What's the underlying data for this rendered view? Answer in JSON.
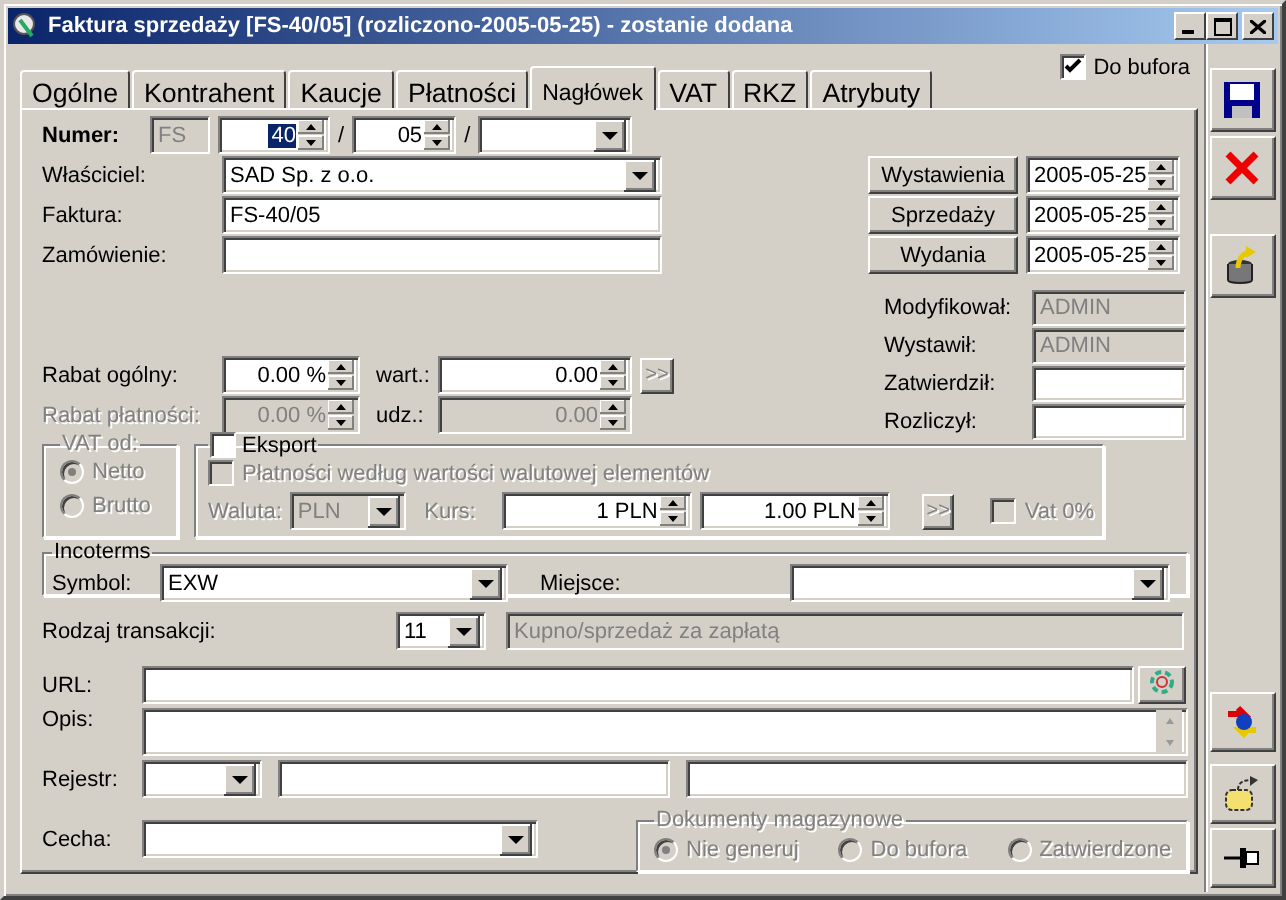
{
  "window": {
    "title": "Faktura sprzedaży [FS-40/05]  (rozliczono-2005-05-25) - zostanie dodana"
  },
  "tabs": [
    {
      "label": "Ogólne",
      "selected": false
    },
    {
      "label": "Kontrahent",
      "selected": false
    },
    {
      "label": "Kaucje",
      "selected": false
    },
    {
      "label": "Płatności",
      "selected": false
    },
    {
      "label": "Nagłówek",
      "selected": true
    },
    {
      "label": "VAT",
      "selected": false
    },
    {
      "label": "RKZ",
      "selected": false
    },
    {
      "label": "Atrybuty",
      "selected": false
    }
  ],
  "buffer": {
    "label": "Do bufora",
    "checked": true
  },
  "numer": {
    "label": "Numer:",
    "prefix": "FS",
    "number": "40",
    "number_selected": true,
    "separator_1": "/",
    "year": "05",
    "separator_2": "/"
  },
  "owner": {
    "label": "Właściciel:",
    "value": "SAD Sp. z o.o."
  },
  "invoice": {
    "label": "Faktura:",
    "value": "FS-40/05"
  },
  "order": {
    "label": "Zamówienie:"
  },
  "dates": [
    {
      "button": "Wystawienia",
      "value": "2005-05-25"
    },
    {
      "button": "Sprzedaży",
      "value": "2005-05-25"
    },
    {
      "button": "Wydania",
      "value": "2005-05-25"
    }
  ],
  "users": [
    {
      "label": "Modyfikował:",
      "value": "ADMIN",
      "disabled": true
    },
    {
      "label": "Wystawił:",
      "value": "ADMIN",
      "disabled": true
    },
    {
      "label": "Zatwierdził:",
      "disabled": false
    },
    {
      "label": "Rozliczył:",
      "disabled": false
    }
  ],
  "discounts": [
    {
      "label": "Rabat ogólny:",
      "percent": "0.00 %",
      "amount_label": "wart.:",
      "amount": "0.00",
      "disabled": false,
      "button": ">>"
    },
    {
      "label": "Rabat płatności:",
      "percent": "0.00 %",
      "amount_label": "udz.:",
      "amount": "0.00",
      "disabled": true
    }
  ],
  "vat_from": {
    "legend": "VAT od:",
    "disabled": true,
    "options": [
      {
        "label": "Netto",
        "selected": true
      },
      {
        "label": "Brutto",
        "selected": false
      }
    ]
  },
  "export": {
    "label": "Eksport",
    "checked": false,
    "payments_label": "Płatności według wartości walutowej elementów",
    "payments_checked": false,
    "currency_label": "Waluta:",
    "currency": "PLN",
    "rate_label": "Kurs:",
    "rate_1": "1 PLN",
    "rate_2": "1.00 PLN",
    "button": ">>",
    "vat0_label": "Vat 0%",
    "vat0_checked": false
  },
  "incoterms": {
    "legend": "Incoterms",
    "symbol_label": "Symbol:",
    "symbol": "EXW",
    "place_label": "Miejsce:"
  },
  "transaction": {
    "label": "Rodzaj transakcji:",
    "code": "11",
    "description": "Kupno/sprzedaż za zapłatą"
  },
  "url": {
    "label": "URL:"
  },
  "description": {
    "label": "Opis:"
  },
  "register": {
    "label": "Rejestr:"
  },
  "feature": {
    "label": "Cecha:"
  },
  "warehouse_docs": {
    "legend": "Dokumenty magazynowe",
    "disabled": true,
    "options": [
      {
        "label": "Nie generuj",
        "selected": true
      },
      {
        "label": "Do bufora",
        "selected": false
      },
      {
        "label": "Zatwierdzone",
        "selected": false
      }
    ]
  }
}
